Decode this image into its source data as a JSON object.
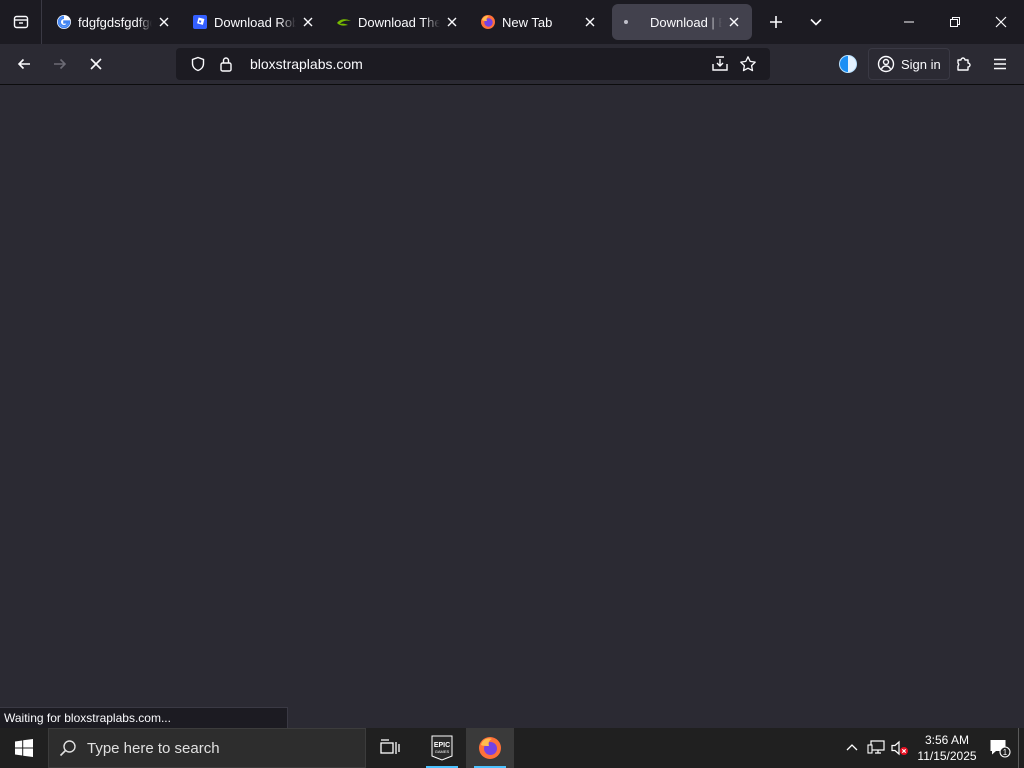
{
  "browser": {
    "tabs": [
      {
        "title": "fdgfgdsfgdfgd -",
        "icon": "google-icon",
        "active": false
      },
      {
        "title": "Download Roblox",
        "icon": "roblox-icon",
        "active": false
      },
      {
        "title": "Download The GeForce",
        "icon": "nvidia-icon",
        "active": false
      },
      {
        "title": "New Tab",
        "icon": "firefox-icon",
        "active": false
      },
      {
        "title": "Download | Bloxstrap",
        "icon": "loading-dot-icon",
        "active": true
      }
    ],
    "url": "bloxstraplabs.com",
    "sign_in_label": "Sign in",
    "status_text": "Waiting for bloxstraplabs.com..."
  },
  "taskbar": {
    "search_placeholder": "Type here to search",
    "apps": [
      {
        "name": "task-view",
        "active": false
      },
      {
        "name": "epic-games",
        "label": "EPIC GAMES",
        "active": false
      },
      {
        "name": "firefox",
        "active": true
      }
    ],
    "time": "3:56 AM",
    "date": "11/15/2025",
    "notification_count": "1"
  },
  "colors": {
    "chrome_dark": "#1c1b22",
    "toolbar": "#2b2a33",
    "active_tab": "#42414d",
    "taskbar": "#202020",
    "accent": "#4cc2ff"
  }
}
